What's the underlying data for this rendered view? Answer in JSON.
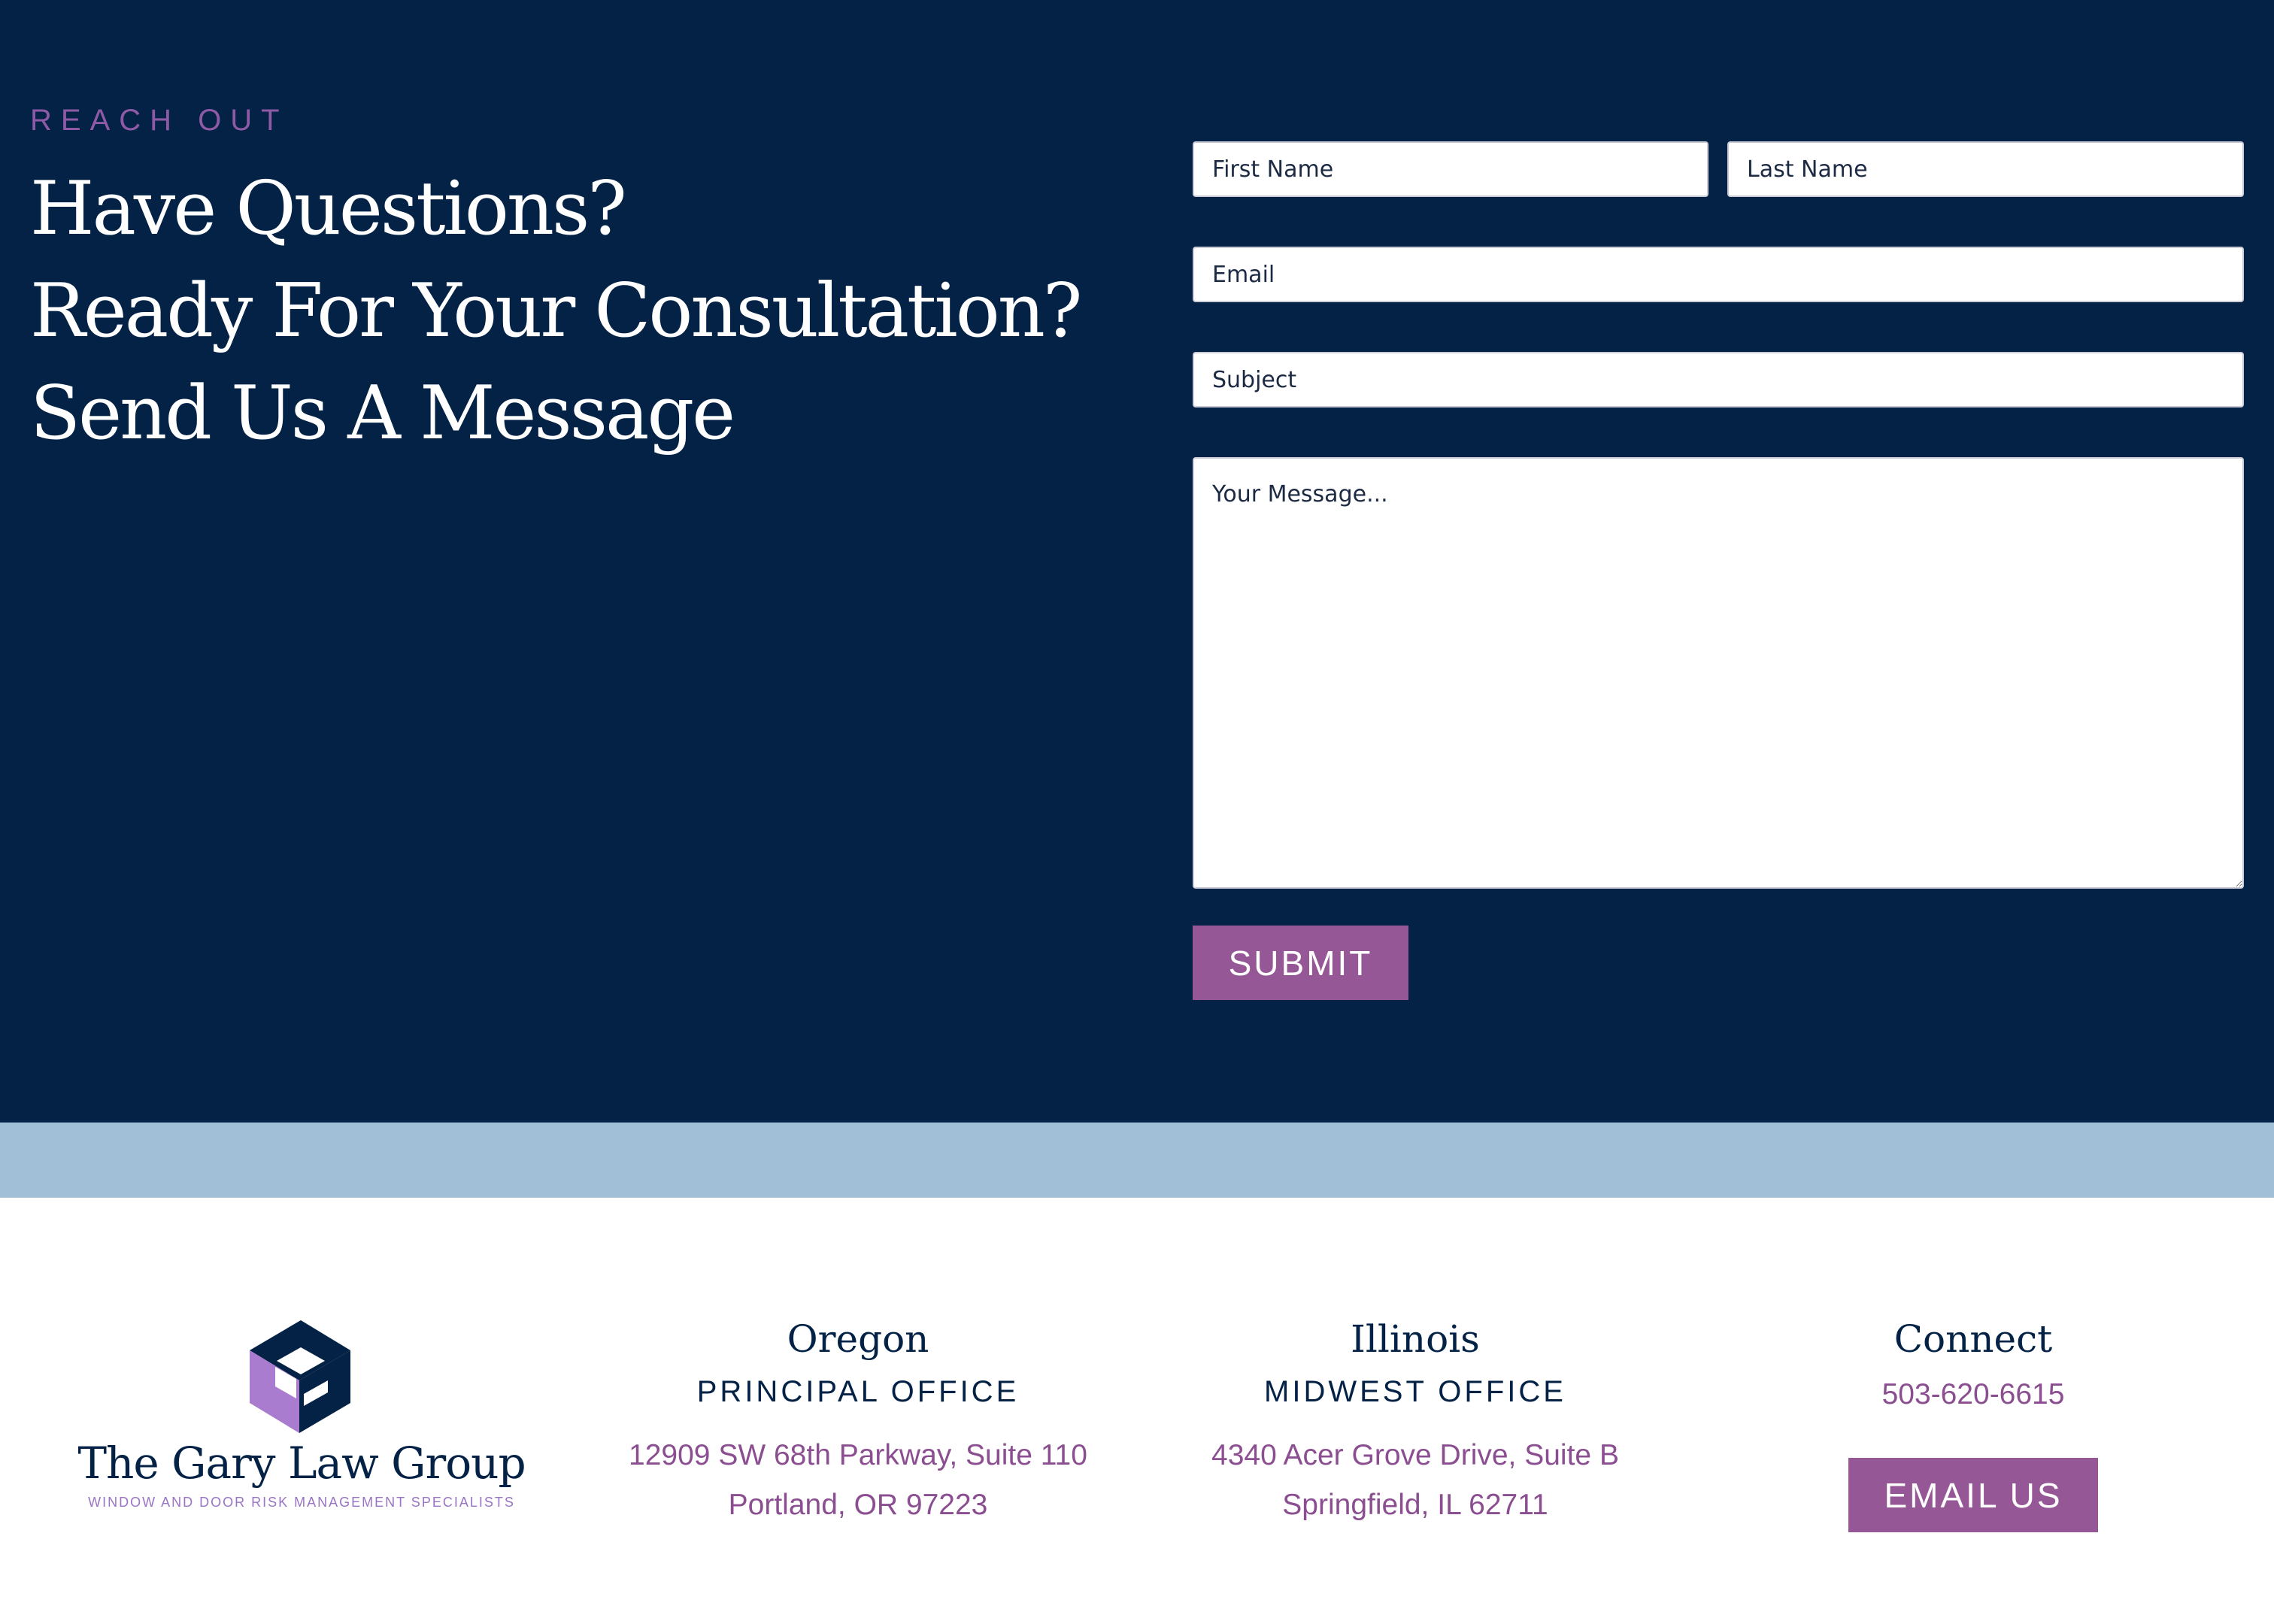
{
  "contact": {
    "eyebrow": "REACH OUT",
    "headline": [
      "Have Questions?",
      "Ready For Your Consultation?",
      "Send Us A Message"
    ],
    "form": {
      "first_name_placeholder": "First Name",
      "last_name_placeholder": "Last Name",
      "email_placeholder": "Email",
      "subject_placeholder": "Subject",
      "message_placeholder": "Your Message...",
      "submit_label": "SUBMIT"
    }
  },
  "footer": {
    "logo": {
      "name": "The Gary Law Group",
      "tagline": "WINDOW AND DOOR RISK MANAGEMENT SPECIALISTS"
    },
    "offices": [
      {
        "title": "Oregon",
        "subtitle": "PRINCIPAL OFFICE",
        "lines": [
          "12909 SW 68th Parkway, Suite 110",
          "Portland, OR 97223"
        ]
      },
      {
        "title": "Illinois",
        "subtitle": "MIDWEST OFFICE",
        "lines": [
          "4340 Acer Grove Drive, Suite B",
          "Springfield, IL 62711"
        ]
      }
    ],
    "connect": {
      "title": "Connect",
      "phone": "503-620-6615",
      "email_button": "EMAIL US"
    }
  },
  "colors": {
    "navy": "#032246",
    "purple": "#955796",
    "light_blue": "#a2bfd8",
    "logo_purple": "#a97ccf"
  }
}
